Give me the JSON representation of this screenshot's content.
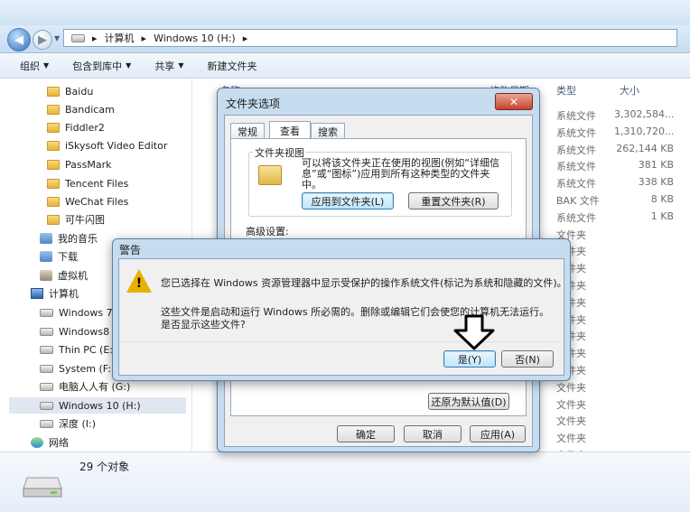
{
  "breadcrumb": [
    "计算机",
    "Windows 10 (H:)"
  ],
  "toolbar": {
    "organize": "组织",
    "include_in_library": "包含到库中",
    "share": "共享",
    "new_folder": "新建文件夹"
  },
  "nav": {
    "items": [
      {
        "label": "Baidu",
        "icon": "folder-icon"
      },
      {
        "label": "Bandicam",
        "icon": "folder-icon"
      },
      {
        "label": "Fiddler2",
        "icon": "folder-icon"
      },
      {
        "label": "iSkysoft Video Editor",
        "icon": "folder-icon"
      },
      {
        "label": "PassMark",
        "icon": "folder-icon"
      },
      {
        "label": "Tencent Files",
        "icon": "folder-icon"
      },
      {
        "label": "WeChat Files",
        "icon": "folder-icon"
      },
      {
        "label": "可牛闪图",
        "icon": "folder-icon"
      },
      {
        "label": "我的音乐",
        "icon": "music-icon"
      },
      {
        "label": "下载",
        "icon": "download-icon"
      },
      {
        "label": "虚拟机",
        "icon": "vm-icon"
      },
      {
        "label": "计算机",
        "icon": "computer-icon"
      },
      {
        "label": "Windows 7",
        "icon": "drive-icon"
      },
      {
        "label": "Windows8 (F",
        "icon": "drive-icon"
      },
      {
        "label": "Thin PC (E:)",
        "icon": "drive-icon"
      },
      {
        "label": "System (F:)",
        "icon": "drive-icon"
      },
      {
        "label": "电脑人人有 (G:)",
        "icon": "drive-icon"
      },
      {
        "label": "Windows 10 (H:)",
        "icon": "drive-icon"
      },
      {
        "label": "深度 (I:)",
        "icon": "drive-icon"
      },
      {
        "label": "网络",
        "icon": "network-icon"
      }
    ]
  },
  "list": {
    "col_name": "名称",
    "col_date": "修改日期",
    "col_type": "类型",
    "col_size": "大小",
    "rows": [
      {
        "type": "系统文件",
        "size": "3,302,584..."
      },
      {
        "type": "系统文件",
        "size": "1,310,720..."
      },
      {
        "type": "系统文件",
        "size": "262,144 KB"
      },
      {
        "type": "系统文件",
        "size": "381 KB"
      },
      {
        "type": "系统文件",
        "size": "338 KB"
      },
      {
        "type": "BAK 文件",
        "size": "8 KB"
      },
      {
        "type": "系统文件",
        "size": "1 KB"
      },
      {
        "type": "文件夹",
        "size": ""
      },
      {
        "type": "文件夹",
        "size": ""
      },
      {
        "type": "文件夹",
        "size": ""
      },
      {
        "type": "文件夹",
        "size": ""
      },
      {
        "type": "文件夹",
        "size": ""
      },
      {
        "type": "文件夹",
        "size": ""
      },
      {
        "type": "文件夹",
        "size": ""
      },
      {
        "type": "文件夹",
        "size": ""
      },
      {
        "type": "文件夹",
        "size": ""
      },
      {
        "type": "文件夹",
        "size": ""
      },
      {
        "type": "文件夹",
        "size": ""
      },
      {
        "type": "文件夹",
        "size": ""
      },
      {
        "type": "文件夹",
        "size": ""
      },
      {
        "type": "文件夹",
        "size": ""
      },
      {
        "type": "文件夹",
        "size": ""
      }
    ]
  },
  "status": {
    "count": "29 个对象"
  },
  "folder_options": {
    "title": "文件夹选项",
    "tabs": [
      "常规",
      "查看",
      "搜索"
    ],
    "folder_views_label": "文件夹视图",
    "folder_views_text_1": "可以将该文件夹正在使用的视图(例如“详细信",
    "folder_views_text_2": "息”或“图标”)应用到所有这种类型的文件夹",
    "folder_views_text_3": "中。",
    "apply_to_folders": "应用到文件夹(L)",
    "reset_folders": "重置文件夹(R)",
    "advanced_label": "高级设置:",
    "restore_defaults": "还原为默认值(D)",
    "ok": "确定",
    "cancel": "取消",
    "apply": "应用(A)"
  },
  "warning": {
    "title": "警告",
    "line1": "您已选择在 Windows 资源管理器中显示受保护的操作系统文件(标记为系统和隐藏的文件)。",
    "line2": "这些文件是启动和运行 Windows 所必需的。删除或编辑它们会使您的计算机无法运行。",
    "line3": "是否显示这些文件?",
    "yes": "是(Y)",
    "no": "否(N)"
  },
  "colors": {
    "dialog_frame": "#c6dcef",
    "warning_icon": "#e8b100",
    "close_button": "#c6432b"
  }
}
